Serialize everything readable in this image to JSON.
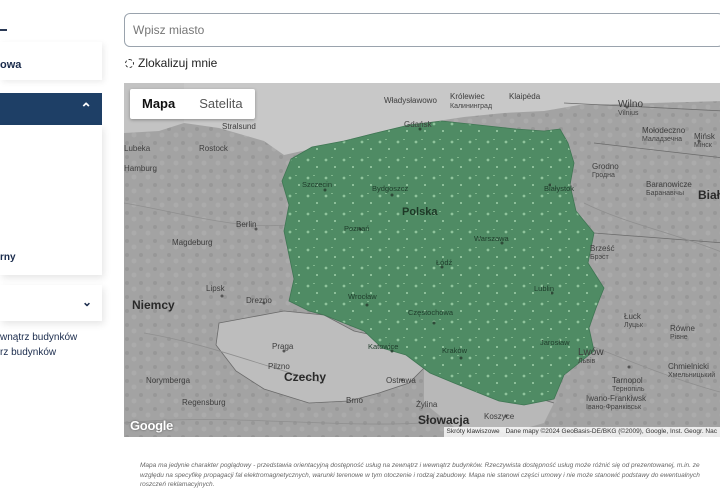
{
  "sidebar": {
    "card_a_label": "owa",
    "panel_label": "rny",
    "options": [
      "wnątrz budynków",
      "rz budynków"
    ]
  },
  "search": {
    "placeholder": "Wpisz miasto"
  },
  "locate": {
    "label": "Zlokalizuj mnie"
  },
  "map": {
    "type_buttons": {
      "map": "Mapa",
      "satellite": "Satelita"
    },
    "coverage_color": "#4f8b64",
    "countries": {
      "poland": "Polska",
      "germany": "Niemcy",
      "czechia": "Czechy",
      "slovakia": "Słowacja",
      "belarus": "Biał"
    },
    "cities": {
      "wladyslawowo": "Władysławowo",
      "krolewiec": "Królewiec",
      "krolewiec_ru": "Калининград",
      "klaipeda": "Klaipėda",
      "wilno": "Wilno",
      "vilnius": "Vilnius",
      "stralsund": "Stralsund",
      "gdansk": "Gdańsk",
      "molodeczno": "Mołodeczno",
      "molodeczno_by": "Маладзечна",
      "minsk": "Mińsk",
      "minsk_by": "Мінск",
      "rostock": "Rostock",
      "lubeck": "Lubeka",
      "hamburg": "Hamburg",
      "szczecin": "Szczecin",
      "bydgoszcz": "Bydgoszcz",
      "grodno": "Grodno",
      "grodno_by": "Гродна",
      "bialystok": "Białystok",
      "baranowicze": "Baranowicze",
      "baranowicze_by": "Баранавічы",
      "berlin": "Berlin",
      "poznan": "Poznań",
      "warszawa": "Warszawa",
      "brzesc": "Brześć",
      "brzesc_by": "Брэст",
      "magdeburg": "Magdeburg",
      "lodz": "Łódź",
      "lublin": "Lublin",
      "lipsk": "Lipsk",
      "wroclaw": "Wrocław",
      "luck": "Łuck",
      "luck_ua": "Луцьк",
      "drezno": "Drezno",
      "czestochowa": "Częstochowa",
      "rowne": "Równe",
      "rowne_ua": "Рівне",
      "katowice": "Katowice",
      "krakow": "Kraków",
      "lwow": "Lwów",
      "lwow_ua": "Львів",
      "praga": "Praga",
      "ostrawa": "Ostrawa",
      "brno": "Brno",
      "pilzno": "Pilzno",
      "norymberga": "Norymberga",
      "regensburg": "Regensburg",
      "zilina": "Żylina",
      "tarnopol": "Tarnopol",
      "tarnopol_ua": "Тернопіль",
      "chmielnicki": "Chmielnicki",
      "chmielnicki_ua": "Хмельницький",
      "stanislawow": "Iwano-Frankiwsk",
      "stanislawow_ua": "Івано-Франківськ",
      "koszyce": "Koszyce",
      "jaroslaw": "Jarosław"
    },
    "attribution": [
      "Skróty klawiszowe",
      "Dane mapy ©2024 GeoBasis-DE/BKG (©2009), Google, Inst. Geogr. Nac"
    ],
    "google_logo": "Google"
  },
  "disclaimer": "Mapa ma jedynie charakter poglądowy - przedstawia orientacyjną dostępność usług na zewnątrz i wewnątrz budynków. Rzeczywista dostępność usług może różnić się od prezentowanej, m.in. ze względu na specyfikę propagacji fal elektromagnetycznych, warunki terenowe w tym otoczenie i rodzaj zabudowy. Mapa nie stanowi części umowy i nie może stanowić podstawy do ewentualnych roszczeń reklamacyjnych."
}
